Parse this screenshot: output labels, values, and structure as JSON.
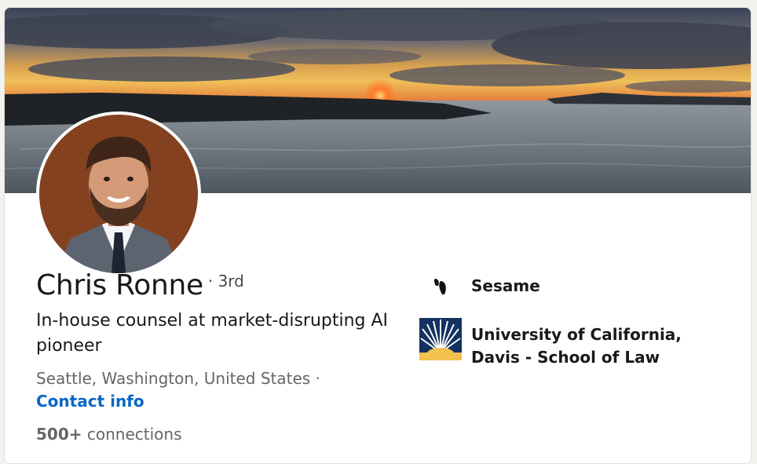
{
  "profile": {
    "name": "Chris Ronne",
    "degree": "· 3rd",
    "headline": "In-house counsel at market-disrupting AI pioneer",
    "location": "Seattle, Washington, United States ·",
    "contact_info_label": "Contact info",
    "connections_count": "500+",
    "connections_label": "connections"
  },
  "organizations": [
    {
      "name": "Sesame",
      "logo_icon": "sesame-logo-icon"
    },
    {
      "name": "University of California, Davis - School of Law",
      "logo_icon": "uc-davis-law-logo-icon"
    }
  ],
  "colors": {
    "link": "#0a66c2",
    "text_primary": "#191919",
    "text_secondary": "#666666",
    "uc_blue": "#14325f",
    "uc_gold": "#f2c14e"
  }
}
